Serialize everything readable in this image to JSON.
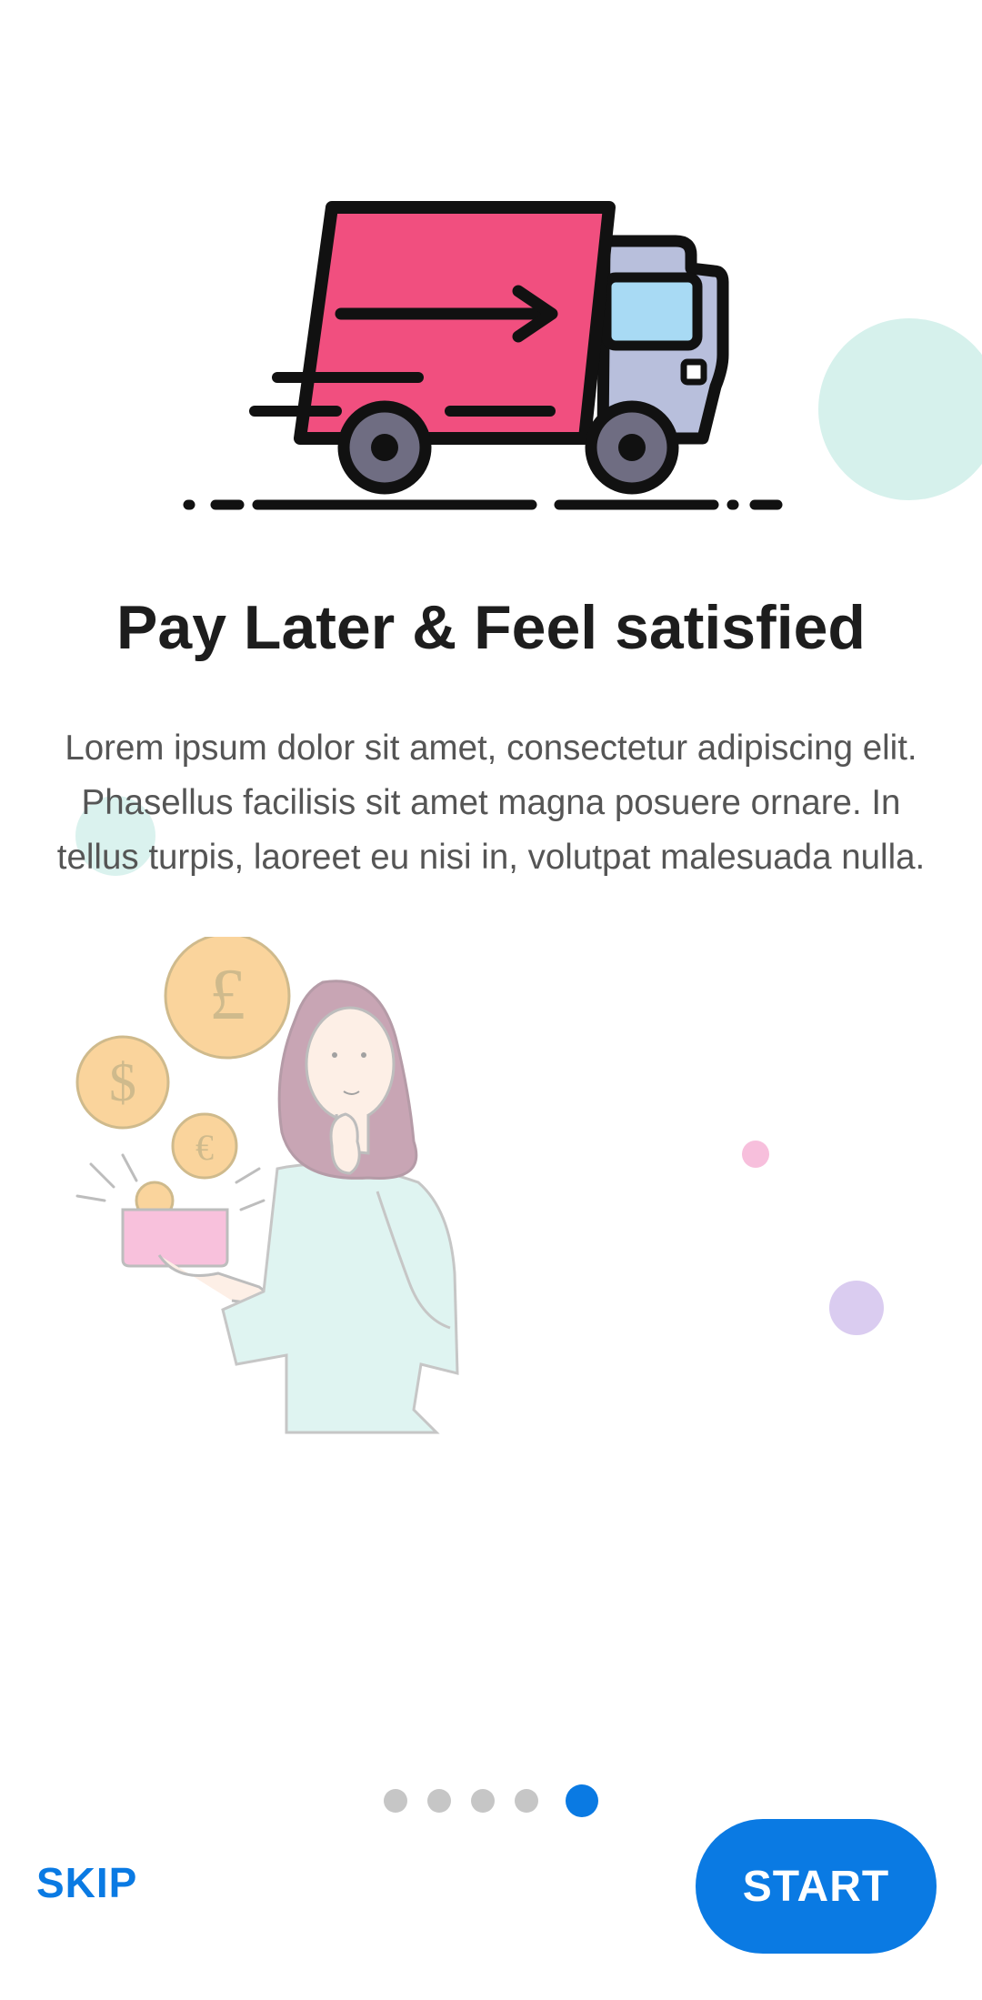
{
  "onboarding": {
    "title": "Pay Later & Feel satisfied",
    "description": "Lorem ipsum dolor sit amet, consectetur adipiscing elit. Phasellus facilisis sit amet magna posuere ornare. In tellus turpis, laoreet eu nisi in, volutpat malesuada nulla.",
    "hero_icon": "delivery-truck-icon",
    "illustration_icon": "woman-thinking-coins-icon"
  },
  "pager": {
    "total_pages": 5,
    "current_page": 5
  },
  "actions": {
    "skip_label": "SKIP",
    "start_label": "START"
  },
  "colors": {
    "accent": "#0a7ae3",
    "truck_body": "#f14f7f",
    "inactive_dot": "#c6c6c6"
  }
}
